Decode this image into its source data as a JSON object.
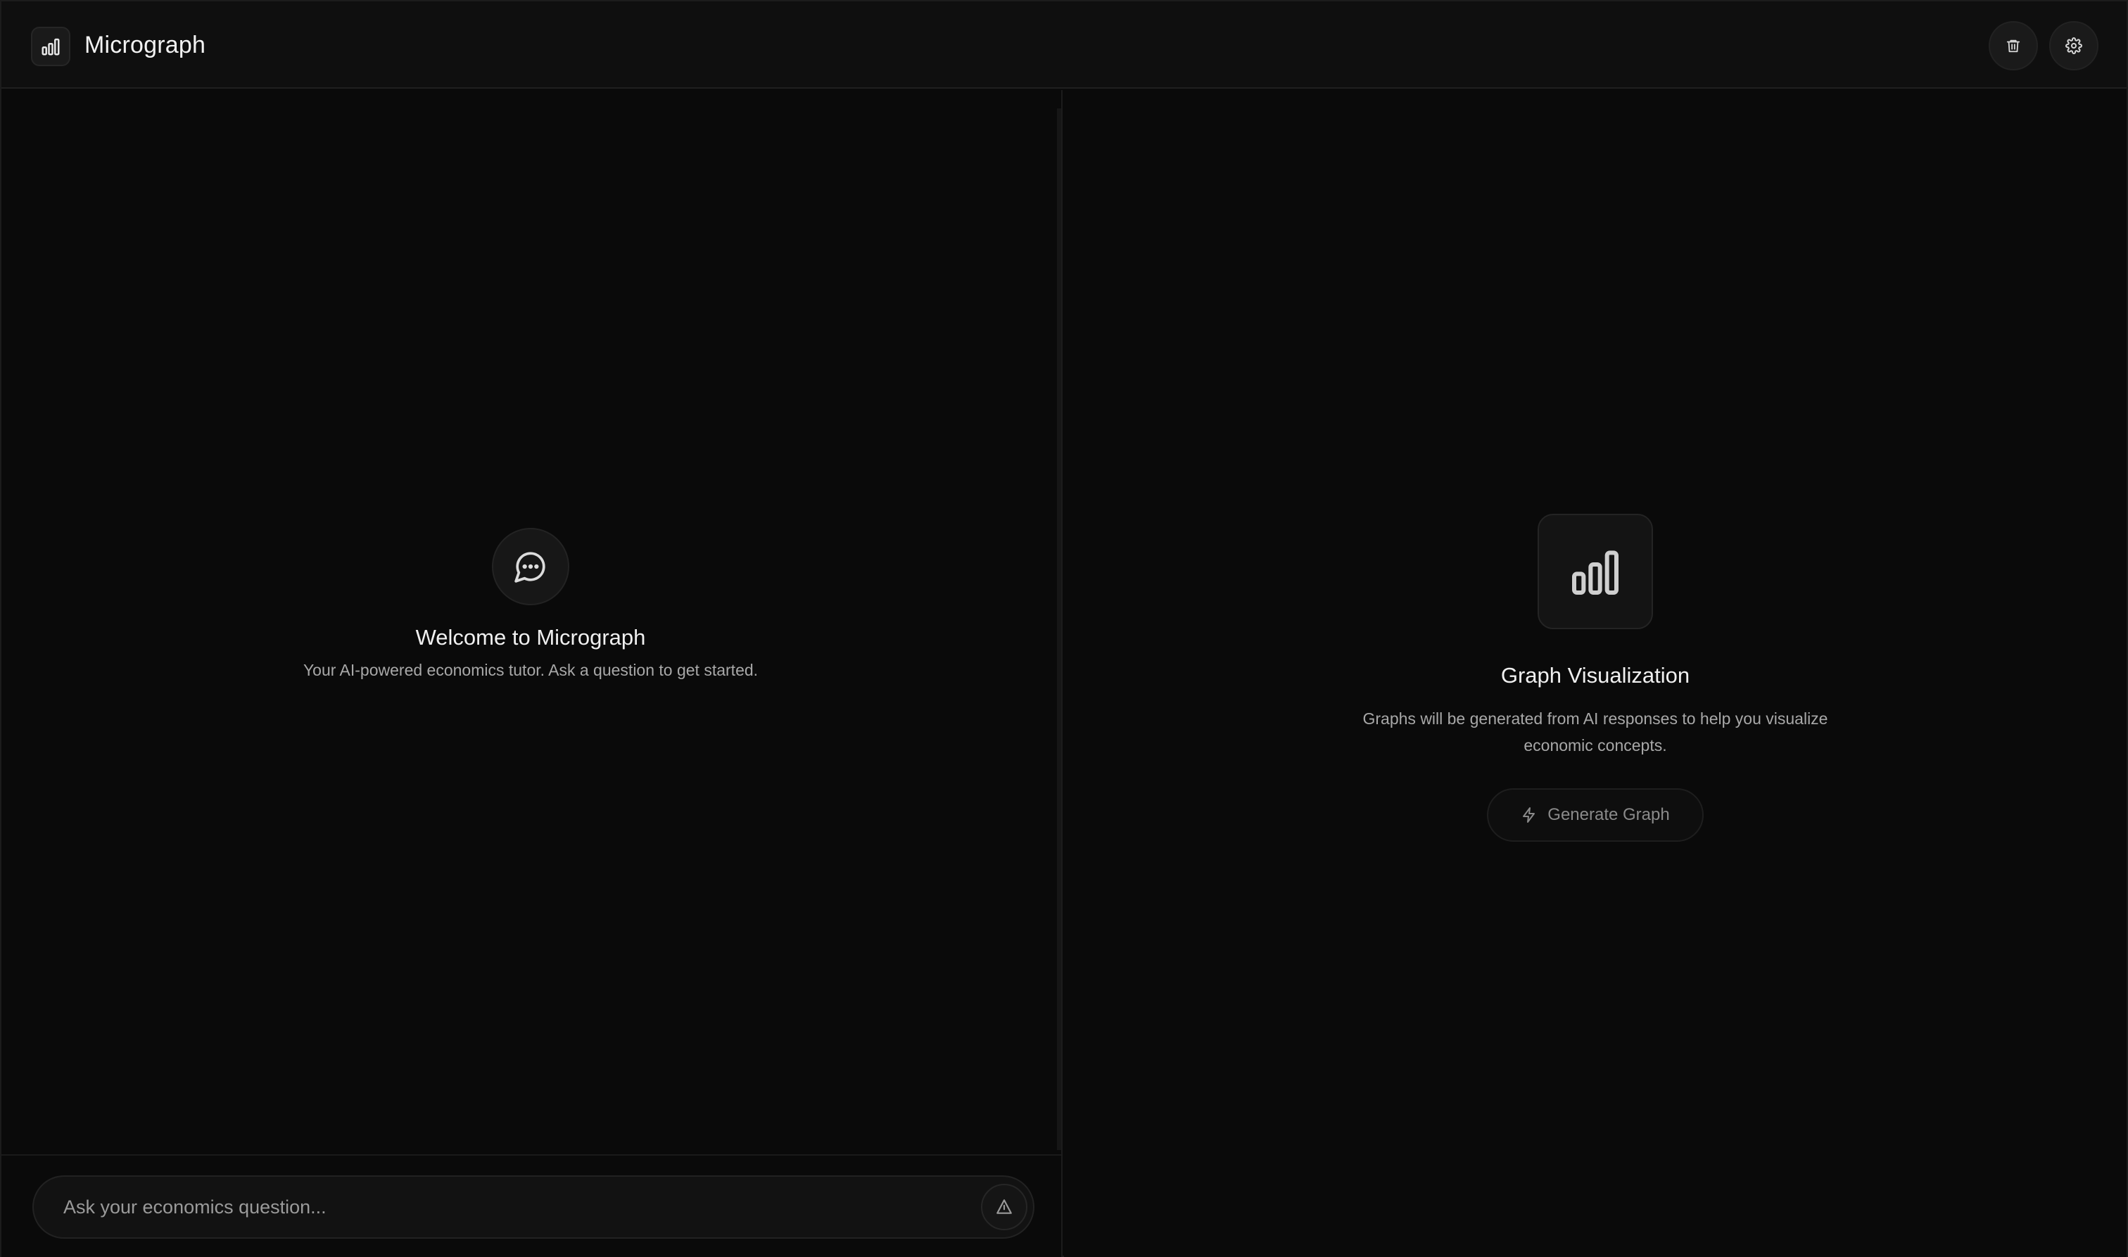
{
  "header": {
    "app_title": "Micrograph",
    "logo_icon": "bar-chart-icon",
    "actions": [
      {
        "name": "trash-icon"
      },
      {
        "name": "gear-icon"
      }
    ]
  },
  "chat": {
    "icon": "message-circle-icon",
    "welcome_title": "Welcome to Micrograph",
    "welcome_subtitle": "Your AI-powered economics tutor. Ask a question to get started.",
    "input_placeholder": "Ask your economics question...",
    "input_value": "",
    "send_icon": "send-icon"
  },
  "graph_panel": {
    "icon": "bar-chart-icon",
    "title": "Graph Visualization",
    "description": "Graphs will be generated from AI responses to help you visualize economic concepts.",
    "generate_label": "Generate Graph",
    "generate_icon": "lightning-icon"
  },
  "colors": {
    "background": "#0a0a0a",
    "header_background": "#0f0f0f",
    "text_primary": "#f0f0f0",
    "text_secondary": "#a8a8a8",
    "text_muted": "#8a8a8a",
    "border": "#1f1f1f"
  }
}
